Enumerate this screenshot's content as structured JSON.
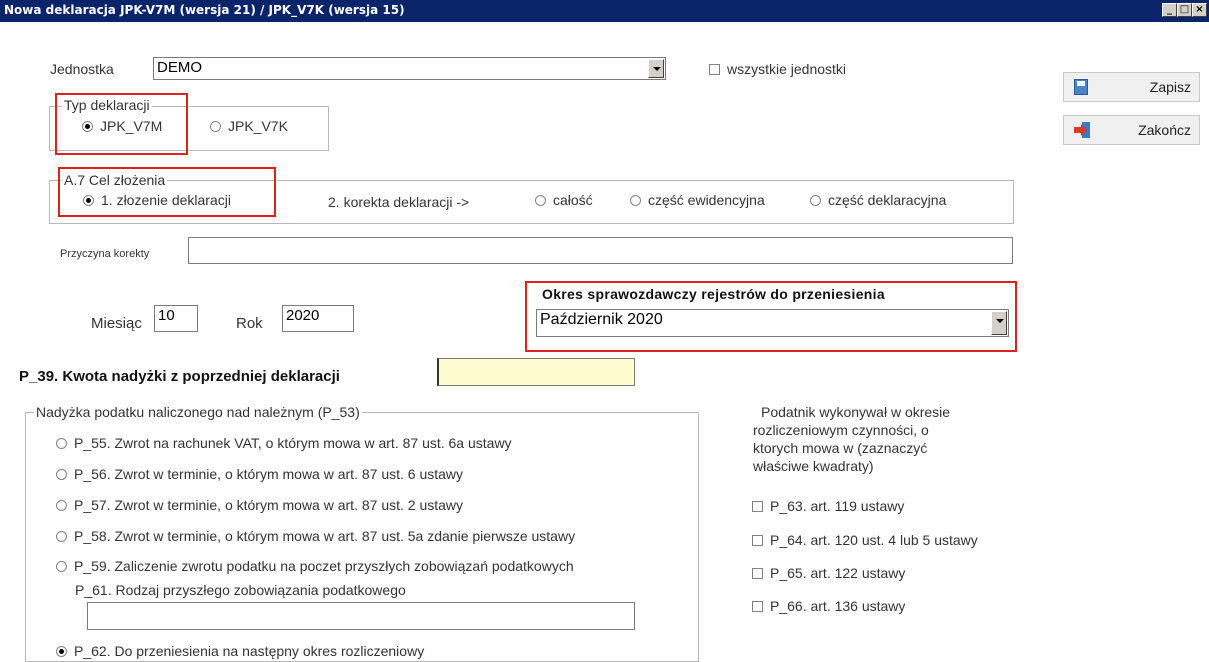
{
  "window": {
    "title": "Nowa deklaracja  JPK-V7M (wersja 21) / JPK_V7K  (wersja 15)",
    "buttons": [
      "_",
      "□",
      "×"
    ]
  },
  "jednostka": {
    "label": "Jednostka",
    "value": "DEMO",
    "all_units_label": "wszystkie jednostki",
    "all_units_checked": false
  },
  "actions": {
    "save_label": "Zapisz",
    "save_icon": "floppy-disk-icon",
    "exit_label": "Zakończ",
    "exit_icon": "exit-door-icon"
  },
  "typ_deklaracji": {
    "legend": "Typ deklaracji",
    "options": [
      "JPK_V7M",
      "JPK_V7K"
    ],
    "selected": "JPK_V7M"
  },
  "cel_zlozenia": {
    "legend": "A.7 Cel złożenia",
    "option1": "1. złozenie deklaracji",
    "correction_label": "2. korekta deklaracji ->",
    "correction_options": [
      "całość",
      "część ewidencyjna",
      "część deklaracyjna"
    ],
    "selected": "1. złozenie deklaracji"
  },
  "przyczyna": {
    "label": "Przyczyna korekty",
    "value": ""
  },
  "okres": {
    "miesiac_label": "Miesiąc",
    "miesiac_value": "10",
    "rok_label": "Rok",
    "rok_value": "2020",
    "registers_label": "Okres sprawozdawczy rejestrów do przeniesienia",
    "registers_value": "Październik 2020"
  },
  "p39": {
    "label": "P_39. Kwota nadyżki z poprzedniej deklaracji",
    "value": ""
  },
  "nadwyzka": {
    "legend": "Nadyżka podatku naliczonego nad należnym  (P_53)",
    "options": [
      "P_55. Zwrot na rachunek VAT, o którym mowa w art. 87 ust. 6a ustawy",
      "P_56. Zwrot w terminie, o którym mowa w art. 87 ust. 6 ustawy",
      "P_57. Zwrot w terminie, o którym mowa w art. 87 ust. 2 ustawy",
      "P_58. Zwrot w terminie, o którym mowa w art. 87 ust. 5a zdanie pierwsze ustawy",
      "P_59. Zaliczenie zwrotu podatku na poczet przyszłych zobowiązań podatkowych"
    ],
    "p61_label": "P_61. Rodzaj przyszłego zobowiązania podatkowego",
    "p61_value": "",
    "p62_label": "P_62. Do przeniesienia  na następny okres rozliczeniowy",
    "selected": "P_62"
  },
  "czynnosci": {
    "heading_lines": [
      "Podatnik wykonywał w okresie",
      "rozliczeniowym czynności, o",
      "ktorych mowa w (zaznaczyć",
      "właściwe kwadraty)"
    ],
    "options": [
      "P_63. art. 119 ustawy",
      "P_64. art. 120 ust. 4 lub 5 ustawy",
      "P_65. art. 122 ustawy",
      "P_66. art. 136 ustawy"
    ]
  },
  "colors": {
    "titlebar": "#0a246a",
    "highlight_border": "#e02020",
    "p39_field": "#fffbd0"
  }
}
